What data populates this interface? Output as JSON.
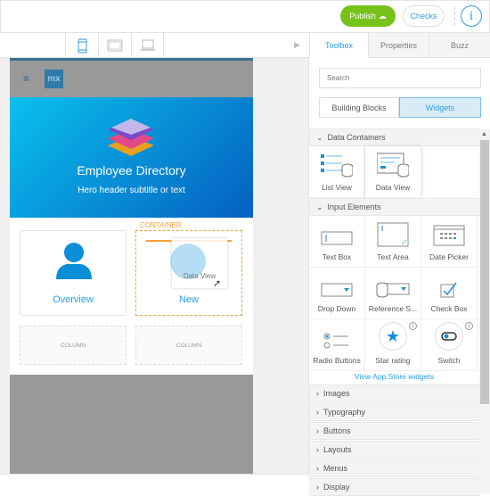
{
  "topbar": {
    "publish": "Publish",
    "checks": "Checks",
    "info_icon": "info-icon"
  },
  "canvas": {
    "hero_title": "Employee Directory",
    "hero_subtitle": "Hero header subtitle or text",
    "logo": "mx",
    "container_label": "CONTAINER",
    "cards": [
      {
        "label": "Overview"
      },
      {
        "label": "New"
      }
    ],
    "columns": [
      "COLUMN",
      "COLUMN"
    ],
    "drag_ghost": "Data View"
  },
  "panel": {
    "tabs": [
      "Toolbox",
      "Properties",
      "Buzz"
    ],
    "search_placeholder": "Search",
    "segments": [
      "Building Blocks",
      "Widgets"
    ],
    "sections": [
      {
        "title": "Data Containers",
        "items": [
          "List View",
          "Data View"
        ]
      },
      {
        "title": "Input Elements",
        "items": [
          "Text Box",
          "Text Area",
          "Date Picker",
          "Drop Down",
          "Reference S...",
          "Check Box",
          "Radio Buttons",
          "Star rating",
          "Switch"
        ]
      }
    ],
    "app_store_link": "View App Store widgets",
    "collapsed": [
      "Images",
      "Typography",
      "Buttons",
      "Layouts",
      "Menus",
      "Display"
    ]
  },
  "colors": {
    "accent": "#2e9ee0",
    "publish": "#76c21b",
    "container": "#f5a13a"
  }
}
